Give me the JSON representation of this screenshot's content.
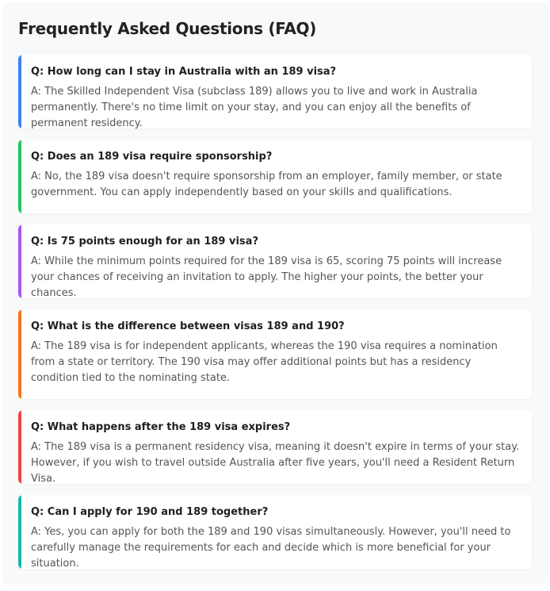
{
  "faq": {
    "title": "Frequently Asked Questions (FAQ)",
    "items": [
      {
        "question": "Q: How long can I stay in Australia with an 189 visa?",
        "answer": "A: The Skilled Independent Visa (subclass 189) allows you to live and work in Australia permanently. There's no time limit on your stay, and you can enjoy all the benefits of permanent residency.",
        "accent_color": "#3b82f6"
      },
      {
        "question": "Q: Does an 189 visa require sponsorship?",
        "answer": "A: No, the 189 visa doesn't require sponsorship from an employer, family member, or state government. You can apply independently based on your skills and qualifications.",
        "accent_color": "#22c55e"
      },
      {
        "question": "Q: Is 75 points enough for an 189 visa?",
        "answer": "A: While the minimum points required for the 189 visa is 65, scoring 75 points will increase your chances of receiving an invitation to apply. The higher your points, the better your chances.",
        "accent_color": "#a855f7"
      },
      {
        "question": "Q: What is the difference between visas 189 and 190?",
        "answer": "A: The 189 visa is for independent applicants, whereas the 190 visa requires a nomination from a state or territory. The 190 visa may offer additional points but has a residency condition tied to the nominating state.",
        "accent_color": "#f97316"
      },
      {
        "question": "Q: What happens after the 189 visa expires?",
        "answer": "A: The 189 visa is a permanent residency visa, meaning it doesn't expire in terms of your stay. However, if you wish to travel outside Australia after five years, you'll need a Resident Return Visa.",
        "accent_color": "#ef4444"
      },
      {
        "question": "Q: Can I apply for 190 and 189 together?",
        "answer": "A: Yes, you can apply for both the 189 and 190 visas simultaneously. However, you'll need to carefully manage the requirements for each and decide which is more beneficial for your situation.",
        "accent_color": "#14b8a6"
      }
    ]
  }
}
